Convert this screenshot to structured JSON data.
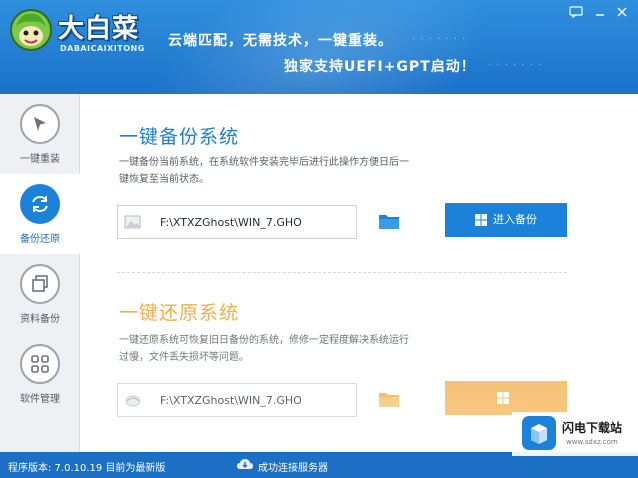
{
  "header": {
    "logo_main": "大白菜",
    "logo_sub": "DABAICAIXITONG",
    "slogan_line1": "云端匹配，无需技术，一键重装。",
    "slogan_line2": "独家支持UEFI+GPT启动！",
    "brand_color": "#1b72c9"
  },
  "sidebar": {
    "items": [
      {
        "label": "一键重装",
        "icon": "cursor-icon",
        "active": false
      },
      {
        "label": "备份还原",
        "icon": "refresh-icon",
        "active": true
      },
      {
        "label": "资料备份",
        "icon": "copy-icon",
        "active": false
      },
      {
        "label": "软件管理",
        "icon": "grid-icon",
        "active": false
      }
    ]
  },
  "backup": {
    "title": "一键备份系统",
    "desc": "一键备份当前系统，在系统软件安装完毕后进行此操作方便日后一键恢复至当前状态。",
    "path": "F:\\XTXZGhost\\WIN_7.GHO",
    "button": "进入备份",
    "button_color": "#1c82d9"
  },
  "restore": {
    "title": "一键还原系统",
    "desc": "一键还原系统可恢复旧日备份的系统，修修一定程度解决系统运行过慢，文件丢失损坏等问题。",
    "path": "F:\\XTXZGhost\\WIN_7.GHO",
    "button_color": "#f4b251"
  },
  "status": {
    "version": "程序版本: 7.0.10.19  目前为最新版",
    "cloud_text": "成功连接服务器"
  },
  "watermark": {
    "title": "闪电下载站",
    "url": "www.sdxz.com"
  }
}
